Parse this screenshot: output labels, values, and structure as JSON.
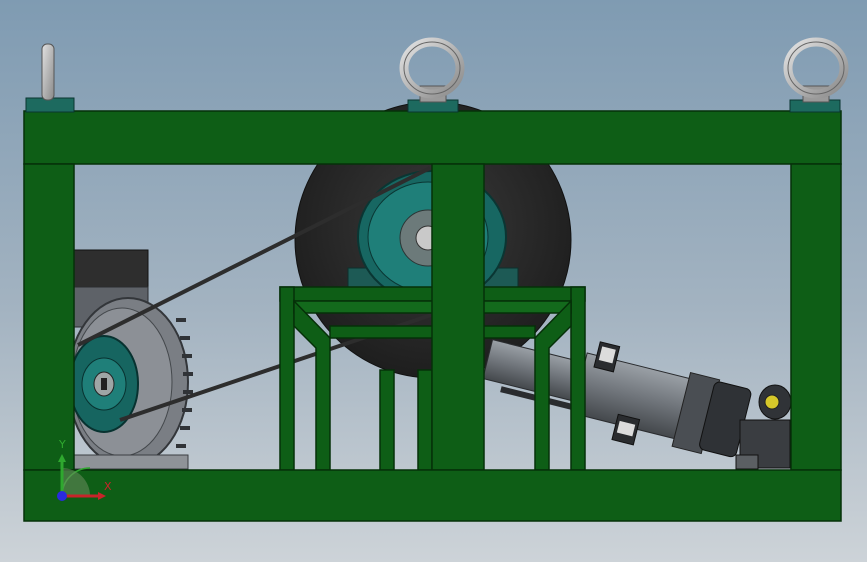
{
  "viewport": {
    "background_top": "#7f9bb2",
    "background_bottom": "#cdd3d8"
  },
  "model": {
    "frame_color": "#0e5e16",
    "pulley_color": "#1a6d6a",
    "motor_color": "#7c8086",
    "flywheel_color": "#2c2c2c",
    "eyebolt_color": "#b0b0b0"
  },
  "triad": {
    "x_label": "X",
    "y_label": "Y",
    "x_color": "#c8242a",
    "y_color": "#2fa82f",
    "z_color": "#2a2ae0"
  }
}
